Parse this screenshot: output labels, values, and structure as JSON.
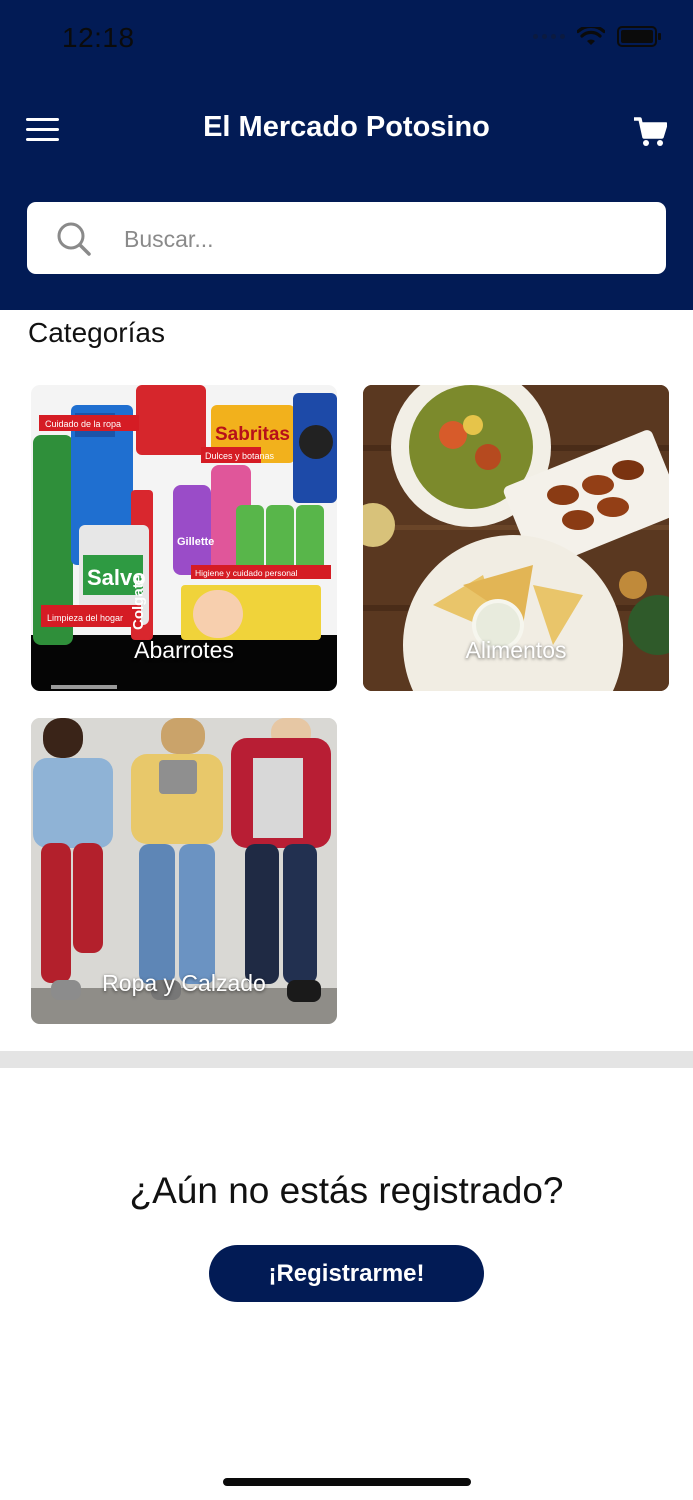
{
  "status_bar": {
    "time": "12:18"
  },
  "header": {
    "title": "El Mercado Potosino",
    "menu_icon": "hamburger-icon",
    "cart_icon": "cart-icon"
  },
  "search": {
    "placeholder": "Buscar...",
    "value": ""
  },
  "categories": {
    "title": "Categorías",
    "items": [
      {
        "label": "Abarrotes",
        "image_text": [
          "Cuidado de la ropa",
          "Dulces y botanas",
          "Sabritas",
          "Higiene y cuidado personal",
          "Limpieza del hogar",
          "Salvo",
          "Colgate",
          "Gillette"
        ]
      },
      {
        "label": "Alimentos"
      },
      {
        "label": "Ropa y Calzado"
      }
    ]
  },
  "register": {
    "question": "¿Aún no estás registrado?",
    "button_label": "¡Registrarme!"
  },
  "colors": {
    "primary": "#021b55",
    "divider": "#e4e4e4"
  }
}
